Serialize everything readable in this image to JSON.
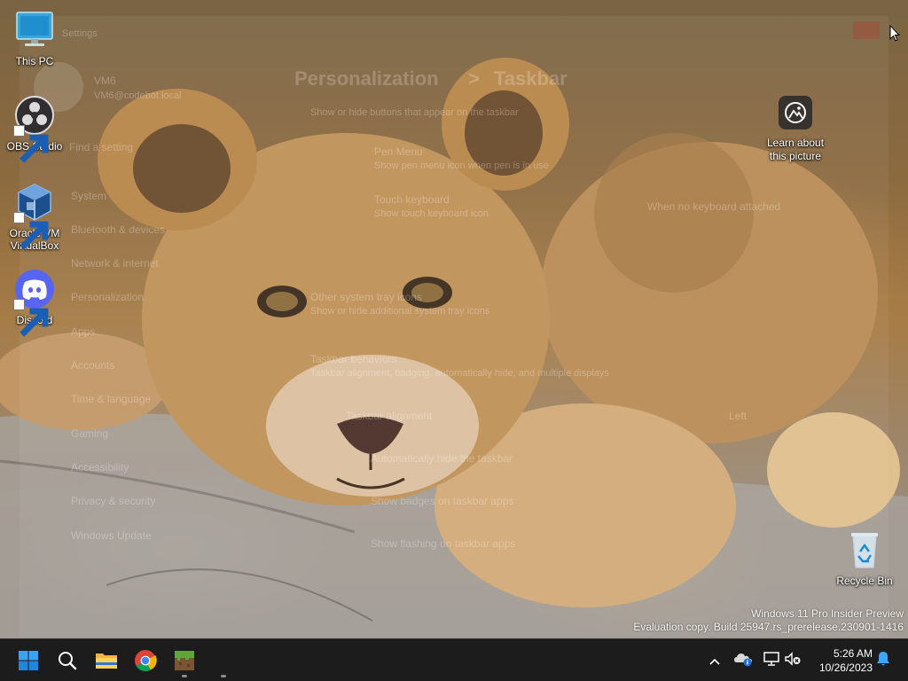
{
  "desktop": {
    "icons": [
      {
        "label": "This PC",
        "icon": "monitor-icon"
      },
      {
        "label": "OBS Studio",
        "icon": "obs-icon"
      },
      {
        "label": "Oracle VM VirtualBox",
        "icon": "virtualbox-icon"
      },
      {
        "label": "Discord",
        "icon": "discord-icon"
      },
      {
        "label": "Recycle Bin",
        "icon": "recycle-bin-icon"
      }
    ],
    "learn_picture": {
      "label_line1": "Learn about",
      "label_line2": "this picture",
      "icon": "camera-icon"
    },
    "watermark": {
      "line1": "Windows 11 Pro Insider Preview",
      "line2": "Evaluation copy. Build 25947.rs_prerelease.230901-1416"
    },
    "wallpaper_subject": "lion cub resting on a log"
  },
  "settings_ghost": {
    "title": "Settings",
    "user_name": "VM6",
    "user_email": "VM6@codebot.local",
    "search_placeholder": "Find a setting",
    "breadcrumb_parent": "Personalization",
    "breadcrumb_sep": ">",
    "breadcrumb_current": "Taskbar",
    "nav": [
      "System",
      "Bluetooth & devices",
      "Network & internet",
      "Personalization",
      "Apps",
      "Accounts",
      "Time & language",
      "Gaming",
      "Accessibility",
      "Privacy & security",
      "Windows Update"
    ],
    "content": {
      "partial_header": "Show or hide buttons that appear on the taskbar",
      "pen_menu": "Pen Menu",
      "pen_menu_desc": "Show pen menu icon when pen is in use",
      "touch_keyboard": "Touch keyboard",
      "touch_keyboard_desc": "Show touch keyboard icon",
      "touch_keyboard_value": "When no keyboard attached",
      "other_tray": "Other system tray icons",
      "other_tray_desc": "Show or hide additional system tray icons",
      "behaviors": "Taskbar behaviors",
      "behaviors_desc": "Taskbar alignment, badging, automatically hide, and multiple displays",
      "alignment": "Taskbar alignment",
      "alignment_value": "Left",
      "auto_hide": "Automatically hide the taskbar",
      "show_badges": "Show badges on taskbar apps",
      "show_flashing": "Show flashing on taskbar apps"
    }
  },
  "taskbar": {
    "apps": [
      {
        "name": "start",
        "icon": "windows-logo-icon"
      },
      {
        "name": "search",
        "icon": "search-icon"
      },
      {
        "name": "file-explorer",
        "icon": "folder-icon"
      },
      {
        "name": "chrome",
        "icon": "chrome-icon"
      },
      {
        "name": "minecraft",
        "icon": "minecraft-icon"
      }
    ],
    "tray": {
      "overflow": "chevron-up-icon",
      "onedrive": "onedrive-icon",
      "network": "network-icon",
      "volume_muted": "volume-muted-icon",
      "notifications": "bell-icon"
    },
    "clock": {
      "time": "5:26 AM",
      "date": "10/26/2023"
    }
  },
  "colors": {
    "taskbar": "#1c1c1c",
    "accent": "#0078d4",
    "discord": "#5865f2",
    "chrome_red": "#db4437",
    "chrome_yellow": "#f4b400",
    "chrome_green": "#0f9d58"
  }
}
